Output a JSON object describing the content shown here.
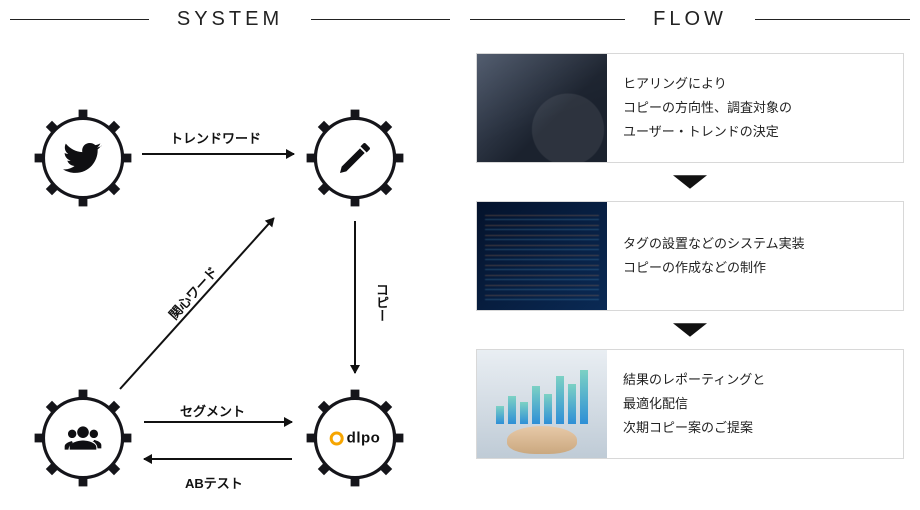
{
  "system": {
    "title": "SYSTEM",
    "nodes": {
      "twitter": "twitter-icon",
      "pen": "pen-icon",
      "users": "users-icon",
      "dlpo": "dlpo"
    },
    "labels": {
      "trend_word": "トレンドワード",
      "interest_word": "関心ワード",
      "copy": "コピー",
      "segment": "セグメント",
      "ab_test": "ABテスト"
    }
  },
  "flow": {
    "title": "FLOW",
    "steps": [
      {
        "line1": "ヒアリングにより",
        "line2": "コピーの方向性、調査対象の",
        "line3": "ユーザー・トレンドの決定"
      },
      {
        "line1": "タグの設置などのシステム実装",
        "line2": "コピーの作成などの制作",
        "line3": ""
      },
      {
        "line1": "結果のレポーティングと",
        "line2": "最適化配信",
        "line3": "次期コピー案のご提案"
      }
    ]
  }
}
